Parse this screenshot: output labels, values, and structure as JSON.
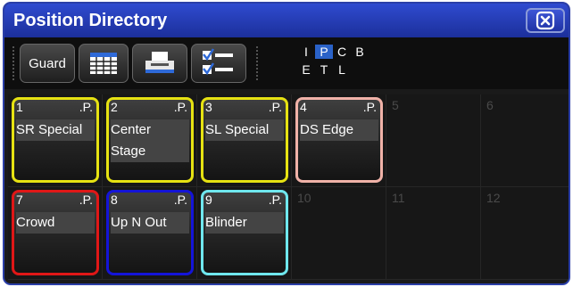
{
  "window": {
    "title": "Position Directory"
  },
  "toolbar": {
    "guard_label": "Guard",
    "letters_row1": [
      "I",
      "P",
      "C",
      "B"
    ],
    "letters_row2": [
      "E",
      "T",
      "L"
    ],
    "active_letter": "P"
  },
  "cells": [
    {
      "num": "1",
      "flag": ".P.",
      "name": "SR Special",
      "color": "#e6e212"
    },
    {
      "num": "2",
      "flag": ".P.",
      "name_line1": "Center",
      "name_line2": "Stage",
      "color": "#e6e212"
    },
    {
      "num": "3",
      "flag": ".P.",
      "name": "SL Special",
      "color": "#e6e212"
    },
    {
      "num": "4",
      "flag": ".P.",
      "name": "DS Edge",
      "color": "#f0b2a8"
    },
    {
      "num": "5"
    },
    {
      "num": "6"
    },
    {
      "num": "7",
      "flag": ".P.",
      "name": "Crowd",
      "color": "#e01717"
    },
    {
      "num": "8",
      "flag": ".P.",
      "name": "Up N Out",
      "color": "#1414d8"
    },
    {
      "num": "9",
      "flag": ".P.",
      "name": "Blinder",
      "color": "#6fe7ee"
    },
    {
      "num": "10"
    },
    {
      "num": "11"
    },
    {
      "num": "12"
    }
  ]
}
